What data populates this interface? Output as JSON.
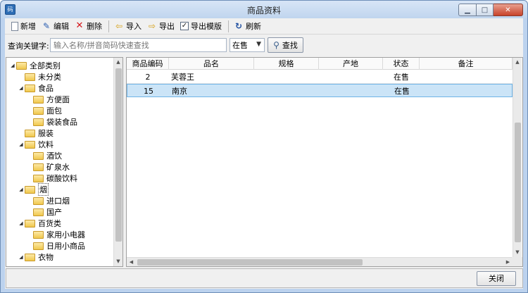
{
  "window": {
    "title": "商品资料",
    "icon_text": "码"
  },
  "toolbar": {
    "new_label": "新增",
    "edit_label": "编辑",
    "delete_label": "删除",
    "import_label": "导入",
    "export_label": "导出",
    "export_template_label": "导出模版",
    "refresh_label": "刷新"
  },
  "search": {
    "label": "查询关键字:",
    "placeholder": "输入名称/拼音简码快速查找",
    "status_selected": "在售",
    "find_label": "查找"
  },
  "tree": {
    "items": [
      {
        "label": "全部类别",
        "level": 0,
        "expand": "◢"
      },
      {
        "label": "未分类",
        "level": 1,
        "expand": ""
      },
      {
        "label": "食品",
        "level": 1,
        "expand": "◢"
      },
      {
        "label": "方便面",
        "level": 2,
        "expand": ""
      },
      {
        "label": "面包",
        "level": 2,
        "expand": ""
      },
      {
        "label": "袋装食品",
        "level": 2,
        "expand": ""
      },
      {
        "label": "服装",
        "level": 1,
        "expand": ""
      },
      {
        "label": "饮料",
        "level": 1,
        "expand": "◢"
      },
      {
        "label": "酒饮",
        "level": 2,
        "expand": ""
      },
      {
        "label": "矿泉水",
        "level": 2,
        "expand": ""
      },
      {
        "label": "碳酸饮料",
        "level": 2,
        "expand": ""
      },
      {
        "label": "烟",
        "level": 1,
        "expand": "◢",
        "selected": true
      },
      {
        "label": "进口烟",
        "level": 2,
        "expand": ""
      },
      {
        "label": "国产",
        "level": 2,
        "expand": ""
      },
      {
        "label": "百货类",
        "level": 1,
        "expand": "◢"
      },
      {
        "label": "家用小电器",
        "level": 2,
        "expand": ""
      },
      {
        "label": "日用小商品",
        "level": 2,
        "expand": ""
      },
      {
        "label": "衣物",
        "level": 1,
        "expand": "◢"
      }
    ]
  },
  "grid": {
    "columns": [
      "商品编码",
      "品名",
      "规格",
      "产地",
      "状态",
      "备注"
    ],
    "rows": [
      {
        "code": "2",
        "name": "芙蓉王",
        "spec": "",
        "origin": "",
        "status": "在售",
        "note": ""
      },
      {
        "code": "15",
        "name": "南京",
        "spec": "",
        "origin": "",
        "status": "在售",
        "note": "",
        "selected": true
      }
    ]
  },
  "footer": {
    "close_label": "关闭"
  }
}
